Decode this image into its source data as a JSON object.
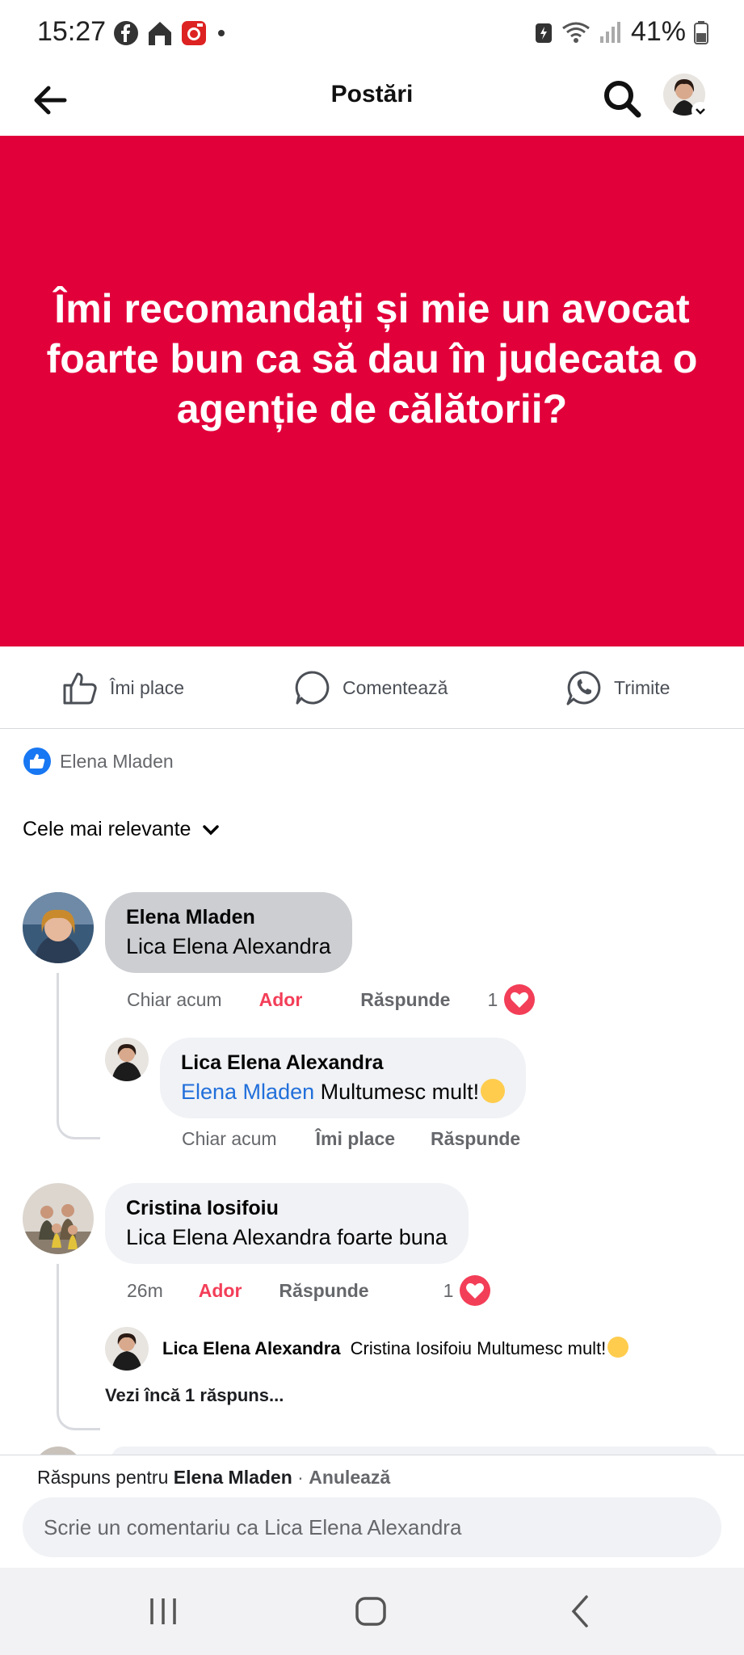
{
  "status": {
    "time": "15:27",
    "battery": "41%"
  },
  "header": {
    "title": "Postări"
  },
  "post": {
    "text": "Îmi recomandați și mie un avocat foarte bun ca să dau în judecata o agenție de călătorii?",
    "background_color": "#e2003b"
  },
  "actions": {
    "like": "Îmi place",
    "comment": "Comentează",
    "share": "Trimite"
  },
  "reactions": {
    "name": "Elena Mladen"
  },
  "sort": {
    "label": "Cele mai relevante"
  },
  "comments": [
    {
      "author": "Elena Mladen",
      "text": "Lica Elena Alexandra",
      "time": "Chiar acum",
      "reaction_label": "Ador",
      "reply_label": "Răspunde",
      "reaction_count": "1",
      "replies": [
        {
          "author": "Lica Elena Alexandra",
          "mention": "Elena Mladen",
          "text": "Multumesc mult!",
          "time": "Chiar acum",
          "like_label": "Îmi place",
          "reply_label": "Răspunde"
        }
      ]
    },
    {
      "author": "Cristina Iosifoiu",
      "text": "Lica Elena Alexandra foarte buna",
      "time": "26m",
      "reaction_label": "Ador",
      "reply_label": "Răspunde",
      "reaction_count": "1",
      "replies": [
        {
          "author": "Lica Elena Alexandra",
          "text": "Cristina Iosifoiu Multumesc mult!"
        }
      ],
      "more_replies": "Vezi încă 1 răspuns..."
    }
  ],
  "reply_bar": {
    "prefix": "Răspuns pentru",
    "target": "Elena Mladen",
    "separator": "·",
    "cancel": "Anulează",
    "placeholder": "Scrie un comentariu ca Lica Elena Alexandra"
  },
  "colors": {
    "love": "#f33e58",
    "mention": "#216fdb",
    "like_blue": "#1877f2"
  }
}
